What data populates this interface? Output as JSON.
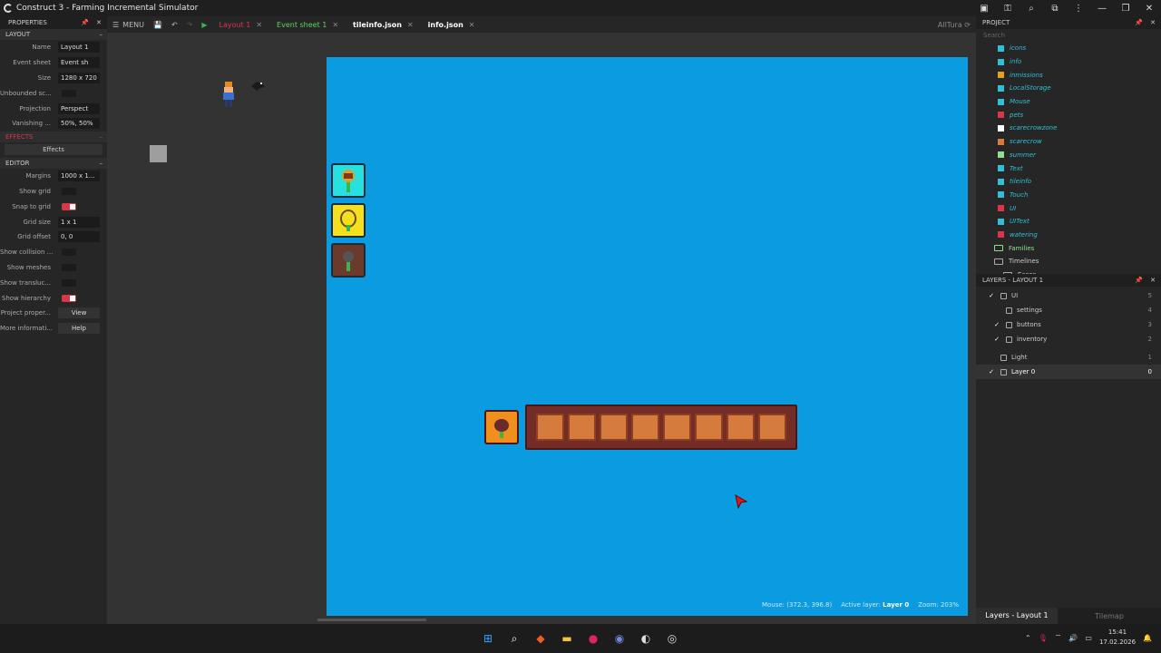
{
  "window": {
    "title": "Construct 3 - Farming Incremental Simulator"
  },
  "toolbar": {
    "menu_label": "MENU",
    "tabs": [
      {
        "label": "Layout 1"
      },
      {
        "label": "Event sheet 1"
      },
      {
        "label": "tileinfo.json"
      },
      {
        "label": "info.json"
      }
    ],
    "user": "AllTura"
  },
  "properties": {
    "header": "PROPERTIES",
    "layout_section": "LAYOUT",
    "layout_rows": [
      {
        "label": "Name",
        "value": "Layout 1"
      },
      {
        "label": "Event sheet",
        "value": "Event sh"
      },
      {
        "label": "Size",
        "value": "1280 x 720"
      },
      {
        "label": "Unbounded sc...",
        "value": ""
      },
      {
        "label": "Projection",
        "value": "Perspect"
      },
      {
        "label": "Vanishing ...",
        "value": "50%, 50%"
      }
    ],
    "effects_section": "EFFECTS",
    "effects_button": "Effects",
    "editor_section": "EDITOR",
    "editor_rows": [
      {
        "label": "Margins",
        "value": "1000 x 1..."
      },
      {
        "label": "Show grid",
        "value": ""
      },
      {
        "label": "Snap to grid",
        "value": ""
      },
      {
        "label": "Grid size",
        "value": "1 x 1"
      },
      {
        "label": "Grid offset",
        "value": "0, 0"
      },
      {
        "label": "Show collision ...",
        "value": ""
      },
      {
        "label": "Show meshes",
        "value": ""
      },
      {
        "label": "Show transluc...",
        "value": ""
      },
      {
        "label": "Show hierarchy",
        "value": ""
      },
      {
        "label": "Project proper...",
        "value": "View"
      },
      {
        "label": "More informati...",
        "value": "Help"
      }
    ]
  },
  "status": {
    "mouse": "Mouse: (372.3, 396.8)",
    "active_layer_label": "Active layer:",
    "active_layer": "Layer 0",
    "zoom": "Zoom: 203%"
  },
  "project": {
    "header": "PROJECT",
    "search_placeholder": "Search",
    "items": [
      "icons",
      "info",
      "inmissions",
      "LocalStorage",
      "Mouse",
      "pets",
      "scarecrowzone",
      "scarecrow",
      "summer",
      "Text",
      "tileinfo",
      "Touch",
      "UI",
      "UIText",
      "watering"
    ],
    "folders": [
      "Families",
      "Timelines",
      "Eases"
    ]
  },
  "layers": {
    "header": "LAYERS - LAYOUT 1",
    "items": [
      {
        "name": "UI",
        "count": "5",
        "checked": true
      },
      {
        "name": "settings",
        "count": "4",
        "checked": false
      },
      {
        "name": "buttons",
        "count": "3",
        "checked": true
      },
      {
        "name": "inventory",
        "count": "2",
        "checked": true
      },
      {
        "name": "Light",
        "count": "1",
        "checked": false
      },
      {
        "name": "Layer 0",
        "count": "0",
        "checked": true
      }
    ],
    "footer_tabs": [
      "Layers - Layout 1",
      "Tilemap"
    ]
  },
  "taskbar": {
    "time": "15:41",
    "date": "17.02.2026"
  },
  "colors": {
    "layout_bg": "#0a9be0",
    "accent_red": "#d8364a",
    "slot": "#d57b3e"
  }
}
